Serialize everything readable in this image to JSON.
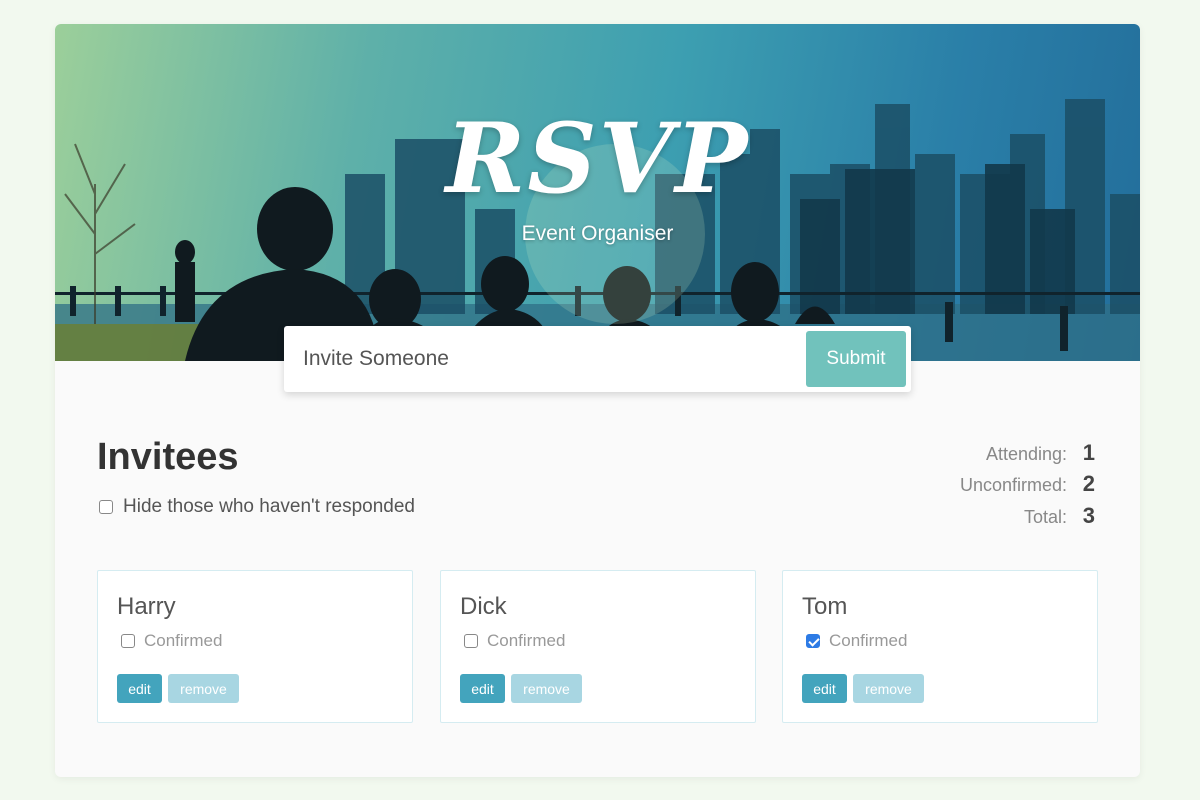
{
  "header": {
    "title": "RSVP",
    "subtitle": "Event Organiser"
  },
  "invite_form": {
    "placeholder": "Invite Someone",
    "value": "",
    "submit_label": "Submit"
  },
  "main": {
    "section_title": "Invitees",
    "filter_label": "Hide those who haven't responded",
    "filter_checked": false,
    "counters": [
      {
        "label": "Attending:",
        "value": "1"
      },
      {
        "label": "Unconfirmed:",
        "value": "2"
      },
      {
        "label": "Total:",
        "value": "3"
      }
    ],
    "guests": [
      {
        "name": "Harry",
        "confirm_label": "Confirmed",
        "confirmed": false,
        "edit_label": "edit",
        "remove_label": "remove"
      },
      {
        "name": "Dick",
        "confirm_label": "Confirmed",
        "confirmed": false,
        "edit_label": "edit",
        "remove_label": "remove"
      },
      {
        "name": "Tom",
        "confirm_label": "Confirmed",
        "confirmed": true,
        "edit_label": "edit",
        "remove_label": "remove"
      }
    ]
  },
  "colors": {
    "page_background": "#f2f9ef",
    "accent": "#71c2bc",
    "edit_button": "#43a4bd",
    "remove_button": "#a8d6e2",
    "checkbox_checked": "#2d7be5"
  }
}
